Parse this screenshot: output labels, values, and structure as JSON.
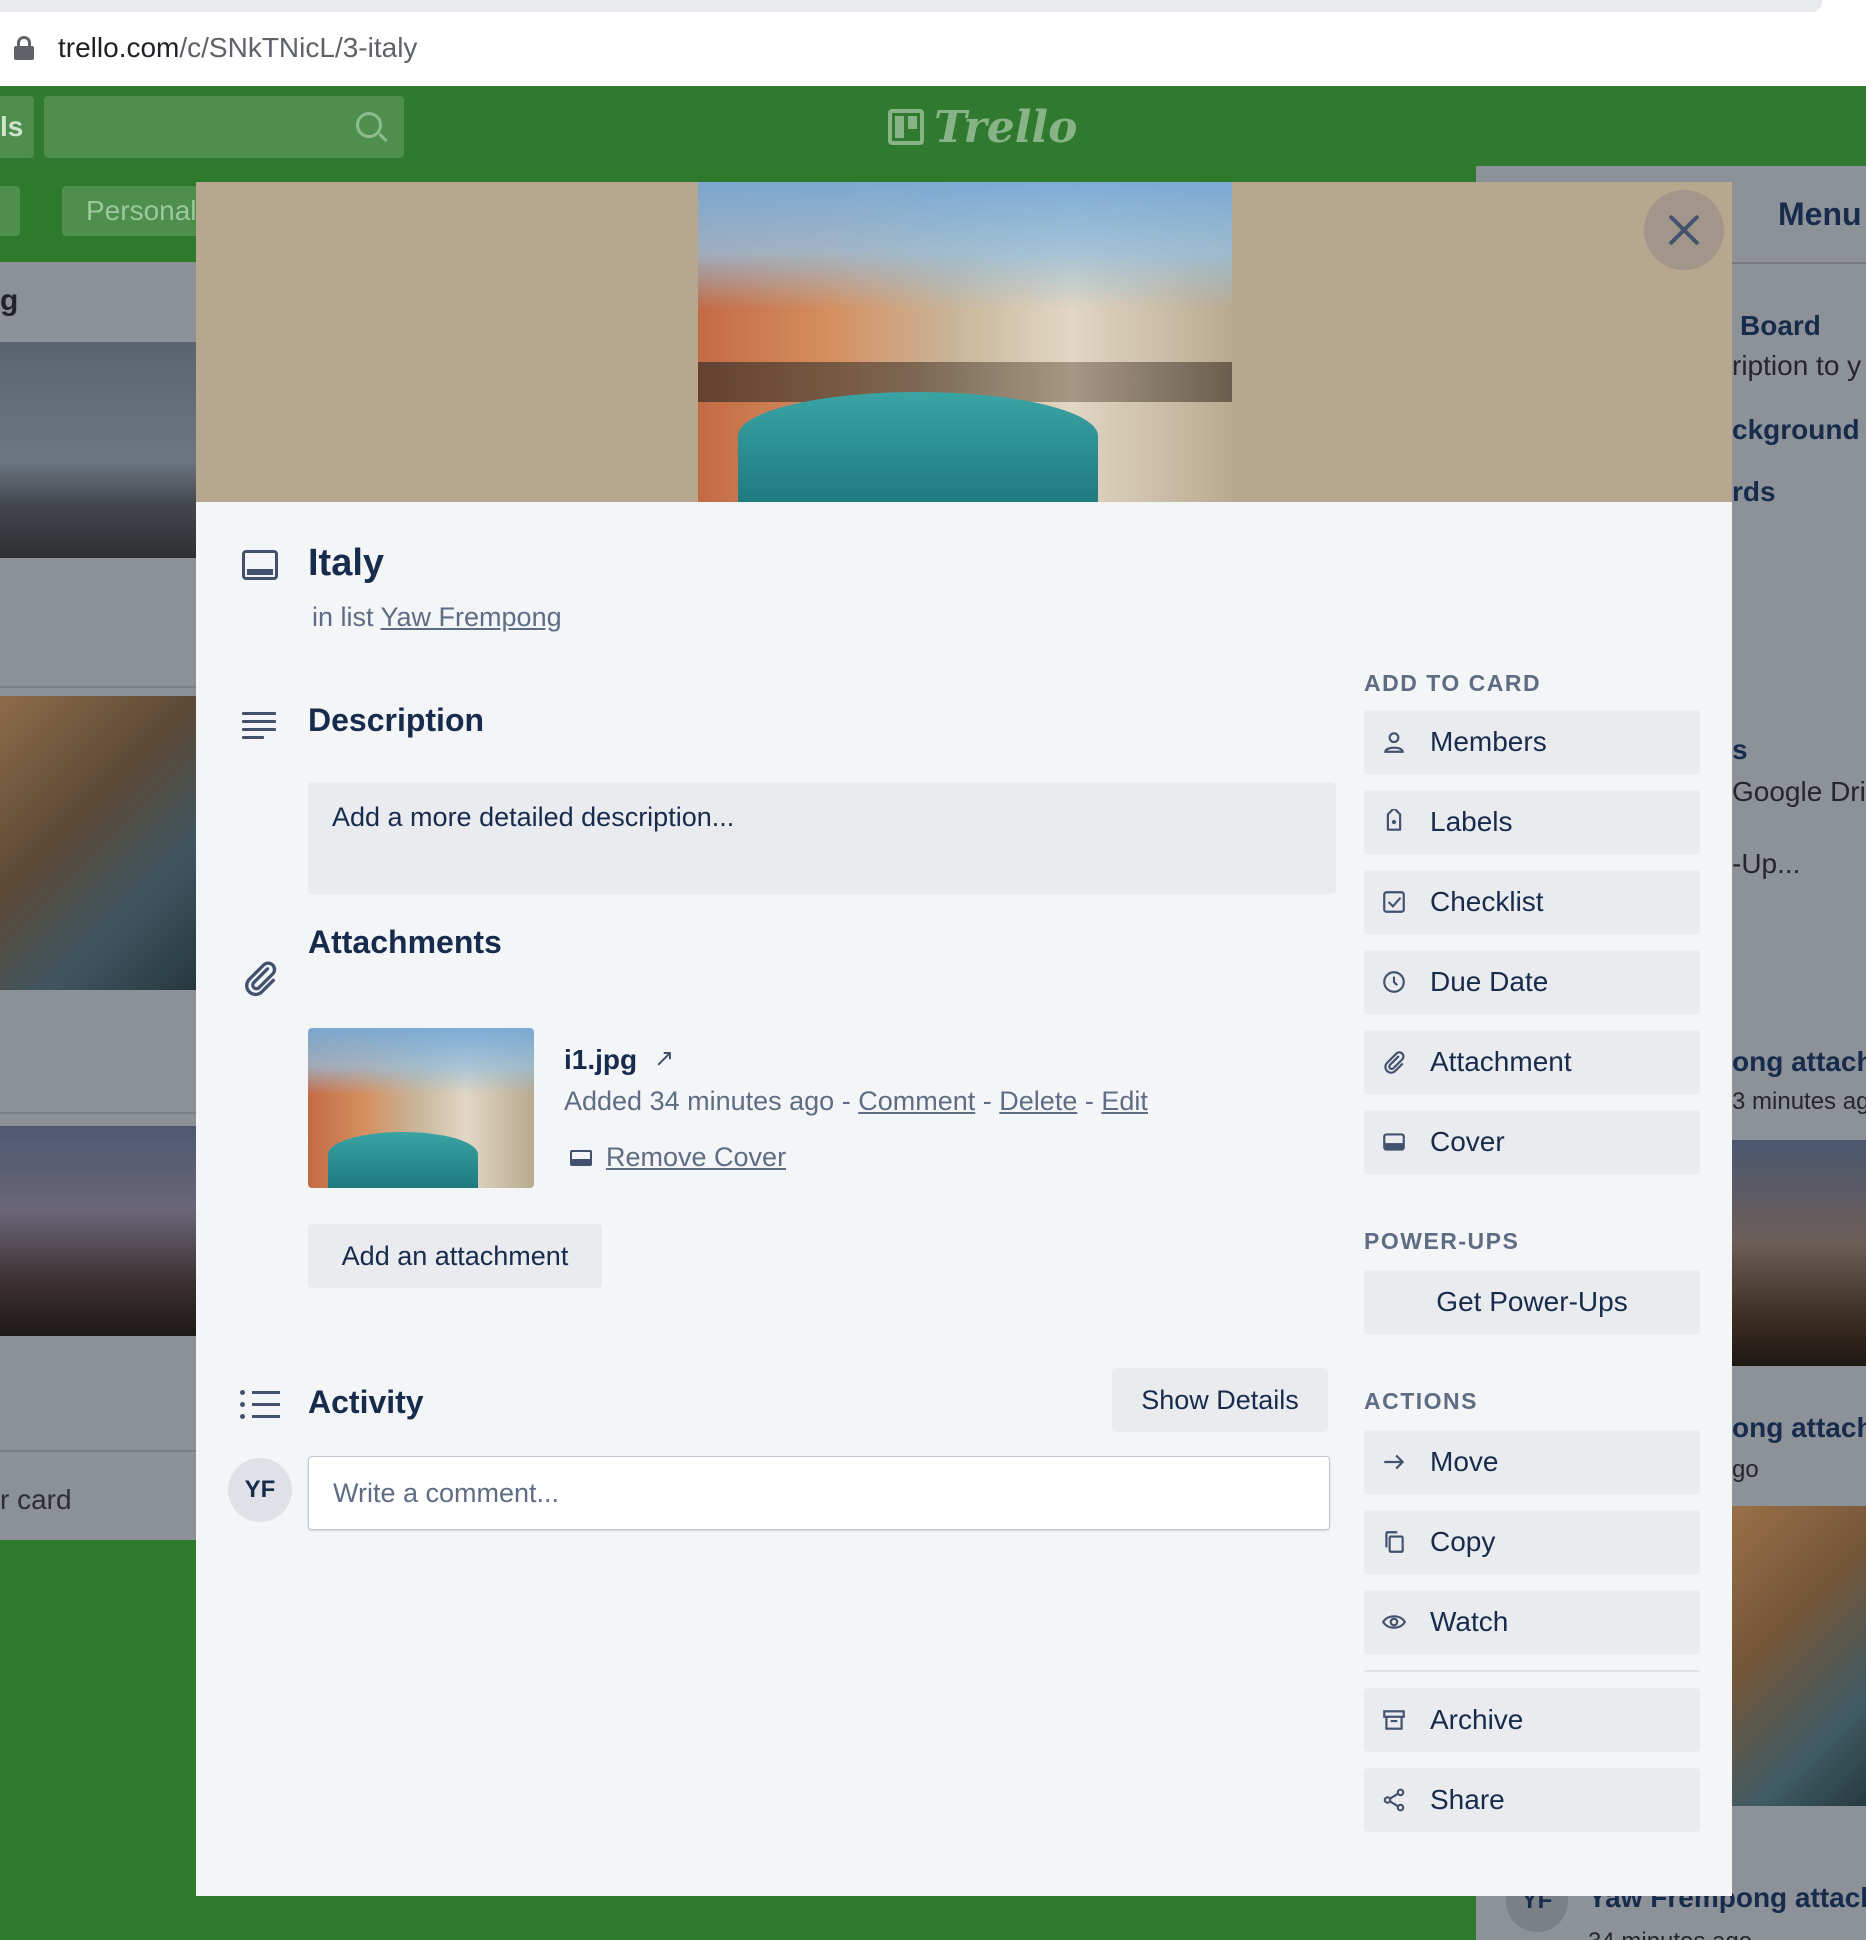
{
  "browser": {
    "url_host": "trello.com",
    "url_path": "/c/SNkTNicL/3-italy"
  },
  "trello_header": {
    "left_text": "ls",
    "logo_text": "Trello",
    "board_button": "Personal"
  },
  "background_list": {
    "title_fragment": "g",
    "add_card_fragment": "r card"
  },
  "background_menu": {
    "title": "Menu",
    "items": [
      "Board",
      "ription to y",
      "ckground",
      "rds",
      "s",
      "Google Driv",
      "-Up...",
      "ong attach",
      "3 minutes ag",
      "ong attach",
      "go",
      "Yaw Frempong attach",
      "34 minutes ago"
    ],
    "avatar": "YF"
  },
  "card": {
    "title": "Italy",
    "in_list_prefix": "in list",
    "list_name": "Yaw Frempong",
    "description": {
      "title": "Description",
      "placeholder": "Add a more detailed description..."
    },
    "attachments": {
      "title": "Attachments",
      "file_name": "i1.jpg",
      "added_text": "Added 34 minutes ago",
      "sep": "-",
      "comment_link": "Comment",
      "delete_link": "Delete",
      "edit_link": "Edit",
      "remove_cover": "Remove Cover",
      "add_button": "Add an attachment"
    },
    "activity": {
      "title": "Activity",
      "show_details": "Show Details",
      "avatar_initials": "YF",
      "comment_placeholder": "Write a comment..."
    }
  },
  "sidebar": {
    "add_to_card_heading": "ADD TO CARD",
    "add_to_card": [
      {
        "label": "Members",
        "icon": "person-icon"
      },
      {
        "label": "Labels",
        "icon": "tag-icon"
      },
      {
        "label": "Checklist",
        "icon": "checklist-icon"
      },
      {
        "label": "Due Date",
        "icon": "clock-icon"
      },
      {
        "label": "Attachment",
        "icon": "paperclip-icon"
      },
      {
        "label": "Cover",
        "icon": "cover-icon"
      }
    ],
    "power_ups_heading": "POWER-UPS",
    "get_power_ups": "Get Power-Ups",
    "actions_heading": "ACTIONS",
    "actions": [
      {
        "label": "Move",
        "icon": "arrow-right-icon"
      },
      {
        "label": "Copy",
        "icon": "copy-icon"
      },
      {
        "label": "Watch",
        "icon": "eye-icon"
      },
      {
        "label": "Archive",
        "icon": "archive-icon"
      },
      {
        "label": "Share",
        "icon": "share-icon"
      }
    ]
  },
  "colors": {
    "board_green": "#2d7a2d",
    "cover_bg": "#b8a78f",
    "modal_bg": "#f4f5f7",
    "text_dark": "#172b4d",
    "text_muted": "#5e6c84"
  }
}
